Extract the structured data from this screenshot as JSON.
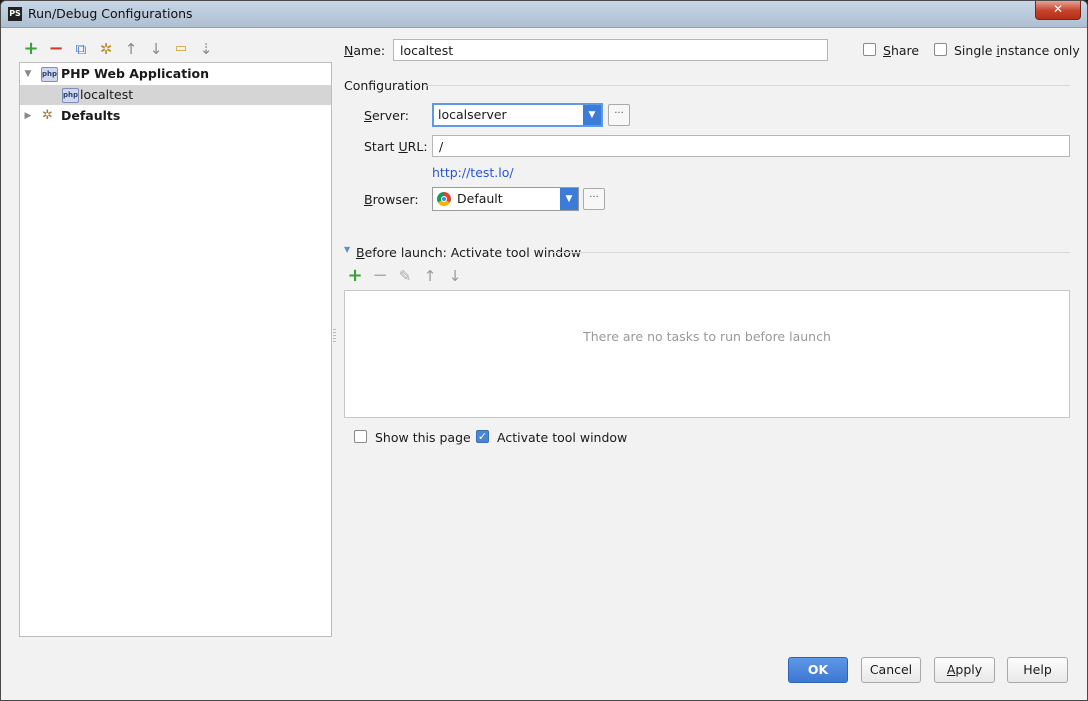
{
  "window": {
    "title": "Run/Debug Configurations",
    "app_icon_text": "PS",
    "close_glyph": "✕"
  },
  "toolbar": {
    "add": "+",
    "remove": "−",
    "copy": "⧉",
    "edit_defaults": "✲",
    "move_up": "↑",
    "move_down": "↓",
    "folder": "▭",
    "sort": "⇣"
  },
  "tree": {
    "php_icon_text": "php",
    "groups": [
      {
        "label": "PHP Web Application",
        "expanded": true,
        "children": [
          "localtest"
        ]
      },
      {
        "label": "Defaults",
        "expanded": false
      }
    ]
  },
  "form": {
    "name_label_pre": "",
    "name_label_u": "N",
    "name_label_post": "ame:",
    "name_value": "localtest",
    "share_label_u": "S",
    "share_label_post": "hare",
    "share_checked": false,
    "single_label_pre": "Single ",
    "single_label_u": "i",
    "single_label_post": "nstance only",
    "single_checked": false,
    "configuration_header": "Configuration",
    "server_label_u": "S",
    "server_label_post": "erver:",
    "server_value": "localserver",
    "start_url_label_pre": "Start ",
    "start_url_label_u": "U",
    "start_url_label_post": "RL:",
    "start_url_value": "/",
    "url_preview": "http://test.lo/",
    "browser_label_u": "B",
    "browser_label_post": "rowser:",
    "browser_value": "Default",
    "ellipsis": "···"
  },
  "before_launch": {
    "header_u": "B",
    "header_post": "efore launch: Activate tool window",
    "add": "+",
    "remove": "−",
    "edit": "✎",
    "up": "↑",
    "down": "↓",
    "empty_text": "There are no tasks to run before launch",
    "show_page_label": "Show this page",
    "show_page_checked": false,
    "activate_label": "Activate tool window",
    "activate_checked": true
  },
  "buttons": {
    "ok": "OK",
    "cancel": "Cancel",
    "apply_u": "A",
    "apply_post": "pply",
    "help": "Help"
  },
  "colors": {
    "accent": "#3d7bd8",
    "add_green": "#3aa03a",
    "remove_red": "#d23a2a",
    "link": "#2b55d4"
  }
}
